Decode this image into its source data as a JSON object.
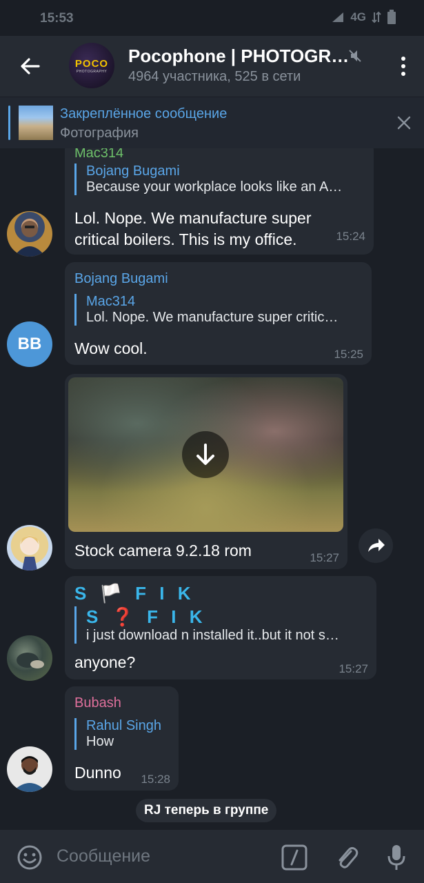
{
  "status_bar": {
    "time": "15:53",
    "network": "4G"
  },
  "header": {
    "title": "Pocophone | PHOTOGR…",
    "subtitle": "4964 участника, 525 в сети",
    "avatar_logo": "POCO",
    "avatar_logo_sub": "PHOTOGRAPHY"
  },
  "pinned": {
    "title": "Закреплённое сообщение",
    "subtitle": "Фотография"
  },
  "messages": [
    {
      "sender": "Mac314",
      "reply_name": "Bojang Bugami",
      "reply_text": "Because your workplace looks like an A…",
      "text_line1": "Lol. Nope. We manufacture super",
      "text_line2": "critical boilers. This is my office.",
      "time": "15:24"
    },
    {
      "sender": "Bojang Bugami",
      "avatar_initials": "BB",
      "reply_name": "Mac314",
      "reply_text": "Lol. Nope. We manufacture super critic…",
      "text": "Wow cool.",
      "time": "15:25"
    },
    {
      "caption": "Stock camera 9.2.18 rom",
      "time": "15:27"
    },
    {
      "sender": "S 🏳️ F I K",
      "reply_name": "S ❓ F I K",
      "reply_text": "i just download n installed it..but it not s…",
      "text": "anyone?",
      "time": "15:27"
    },
    {
      "sender": "Bubash",
      "reply_name": "Rahul Singh",
      "reply_text": "How",
      "text": "Dunno",
      "time": "15:28"
    }
  ],
  "service_message": "RJ теперь в группе",
  "input": {
    "placeholder": "Сообщение"
  },
  "colors": {
    "accent": "#5aa6e8",
    "sender_green": "#6ec16a",
    "sender_pink": "#e0709c",
    "sender_sky": "#3ab6ea"
  }
}
